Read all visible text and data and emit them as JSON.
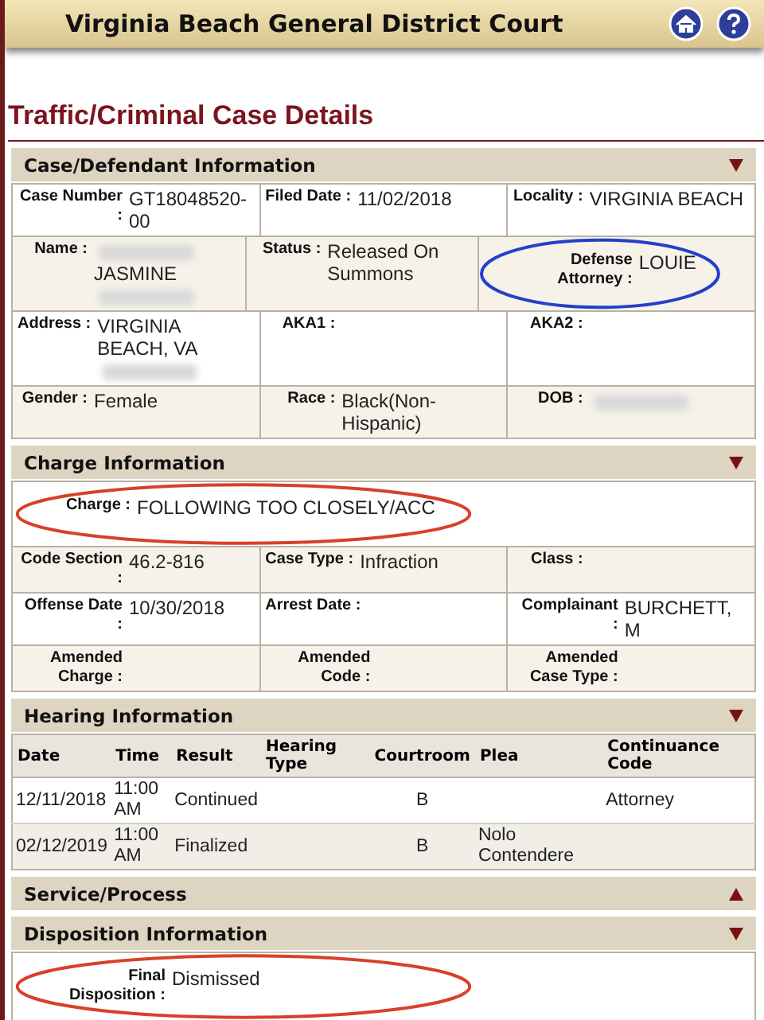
{
  "header": {
    "title": "Virginia Beach General District Court"
  },
  "page_title": "Traffic/Criminal Case Details",
  "sections": [
    {
      "kind": "fields",
      "title": "Case/Defendant Information",
      "expanded": true,
      "rows": [
        [
          {
            "label": "Case Number :",
            "value": [
              {
                "kind": "text",
                "text": "GT18048520-00"
              }
            ]
          },
          {
            "label": "Filed Date :",
            "value": [
              {
                "kind": "text",
                "text": "11/02/2018"
              }
            ]
          },
          {
            "label": "Locality :",
            "value": [
              {
                "kind": "text",
                "text": "VIRGINIA BEACH"
              }
            ]
          }
        ],
        [
          {
            "label": "Name :",
            "value": [
              {
                "kind": "redacted"
              },
              {
                "kind": "text",
                "text": "JASMINE"
              },
              {
                "kind": "redacted"
              }
            ]
          },
          {
            "label": "Status :",
            "value": [
              {
                "kind": "text",
                "text": "Released On Summons"
              }
            ]
          },
          {
            "label": "Defense Attorney :",
            "value": [
              {
                "kind": "text",
                "text": "LOUIE"
              }
            ],
            "color": "#2440c8"
          }
        ],
        [
          {
            "label": "Address :",
            "value": [
              {
                "kind": "text",
                "text": "VIRGINIA BEACH, VA"
              },
              {
                "kind": "redacted"
              }
            ]
          },
          {
            "label": "AKA1 :"
          },
          {
            "label": "AKA2 :"
          }
        ],
        [
          {
            "label": "Gender :",
            "value": [
              {
                "kind": "text",
                "text": "Female"
              }
            ]
          },
          {
            "label": "Race :",
            "value": [
              {
                "kind": "text",
                "text": "Black(Non-Hispanic)"
              }
            ]
          },
          {
            "label": "DOB :",
            "value": [
              {
                "kind": "redacted"
              }
            ]
          }
        ]
      ]
    },
    {
      "kind": "fields",
      "title": "Charge Information",
      "expanded": true,
      "rows": [
        [
          {
            "label": "Charge :",
            "value": [
              {
                "kind": "text",
                "text": "FOLLOWING TOO CLOSELY/ACC"
              }
            ],
            "color": "#d8402a"
          }
        ],
        [
          {
            "label": "Code Section :",
            "value": [
              {
                "kind": "text",
                "text": "46.2-816"
              }
            ]
          },
          {
            "label": "Case Type :",
            "value": [
              {
                "kind": "text",
                "text": "Infraction"
              }
            ]
          },
          {
            "label": "Class :"
          }
        ],
        [
          {
            "label": "Offense Date :",
            "value": [
              {
                "kind": "text",
                "text": "10/30/2018"
              }
            ]
          },
          {
            "label": "Arrest Date :"
          },
          {
            "label": "Complainant :",
            "value": [
              {
                "kind": "text",
                "text": "BURCHETT, M"
              }
            ]
          }
        ],
        [
          {
            "label": "Amended Charge :"
          },
          {
            "label": "Amended Code :"
          },
          {
            "label": "Amended Case Type :"
          }
        ]
      ]
    },
    {
      "kind": "table",
      "title": "Hearing Information",
      "expanded": true,
      "columns": [
        "Date",
        "Time",
        "Result",
        "Hearing Type",
        "Courtroom",
        "Plea",
        "Continuance Code"
      ],
      "rows": [
        [
          "12/11/2018",
          "11:00 AM",
          "Continued",
          "",
          "B",
          "",
          "Attorney"
        ],
        [
          "02/12/2019",
          "11:00 AM",
          "Finalized",
          "",
          "B",
          "Nolo Contendere",
          ""
        ]
      ]
    },
    {
      "kind": "fields",
      "title": "Service/Process",
      "expanded": false
    },
    {
      "kind": "fields",
      "title": "Disposition Information",
      "expanded": true,
      "rows": [
        [
          {
            "label": "Final Disposition :",
            "value": [
              {
                "kind": "text",
                "text": "Dismissed"
              }
            ],
            "color": "#d8402a"
          }
        ]
      ]
    }
  ]
}
